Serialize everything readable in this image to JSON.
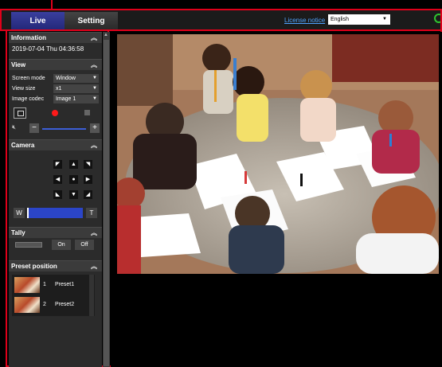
{
  "header": {
    "tabs": [
      {
        "label": "Live"
      },
      {
        "label": "Setting"
      }
    ],
    "license_link": "License notice",
    "language": "English"
  },
  "sidebar": {
    "information": {
      "title": "Information",
      "datetime": "2019-07-04 Thu 04:36:58"
    },
    "view": {
      "title": "View",
      "screen_mode_label": "Screen mode",
      "screen_mode_value": "Window",
      "view_size_label": "View size",
      "view_size_value": "x1",
      "image_codec_label": "Image codec",
      "image_codec_value": "Image 1"
    },
    "camera": {
      "title": "Camera",
      "zoom_wide": "W",
      "zoom_tele": "T"
    },
    "tally": {
      "title": "Tally",
      "on_label": "On",
      "off_label": "Off"
    },
    "preset": {
      "title": "Preset position",
      "items": [
        {
          "num": "1",
          "name": "Preset1"
        },
        {
          "num": "2",
          "name": "Preset2"
        }
      ]
    }
  },
  "colors": {
    "accent_red": "#e0001a",
    "live_tab": "#2f3490",
    "zoom_bar": "#2b45c8"
  }
}
